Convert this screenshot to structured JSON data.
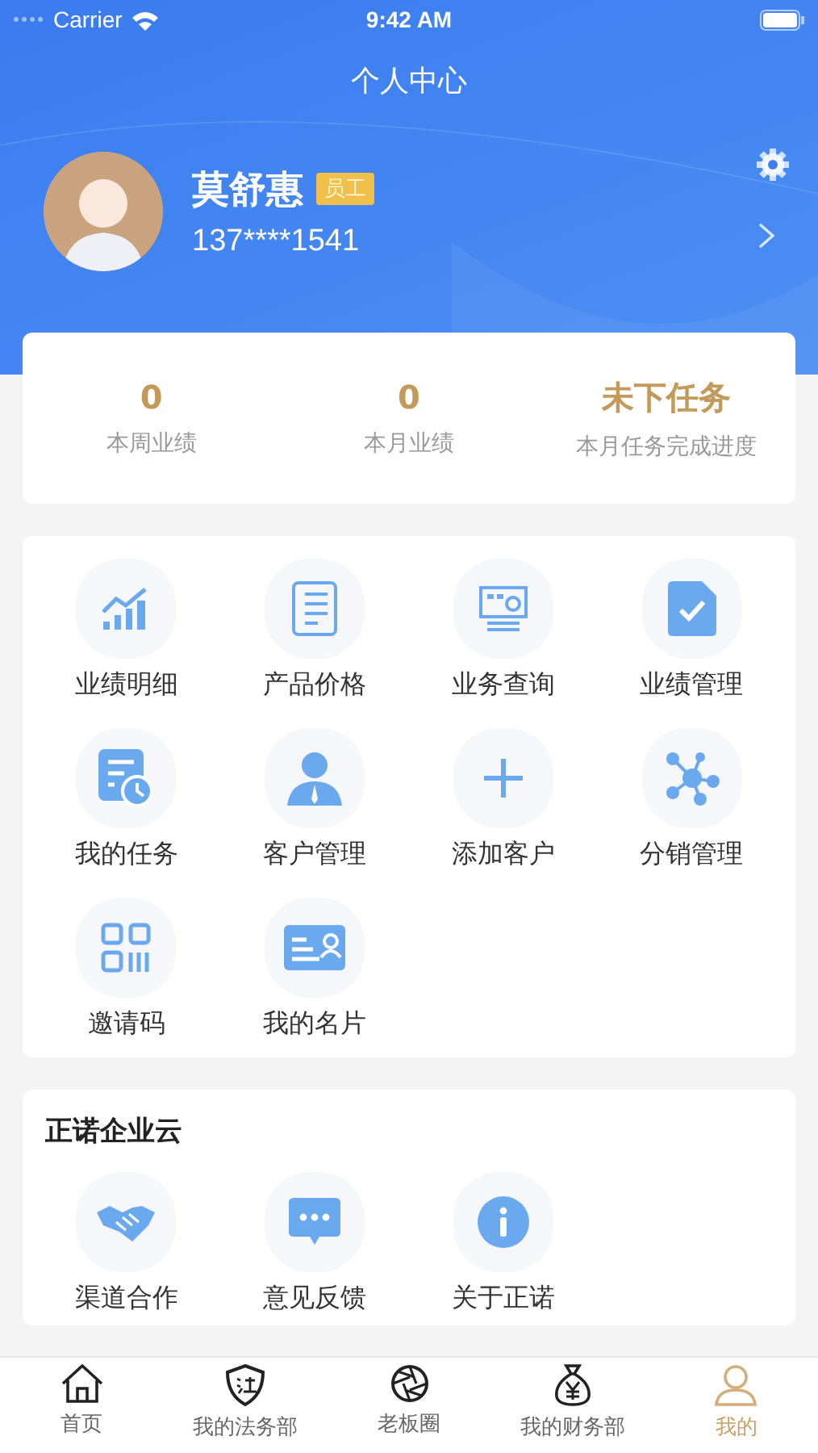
{
  "status_bar": {
    "carrier": "Carrier",
    "time": "9:42 AM"
  },
  "header": {
    "title": "个人中心"
  },
  "profile": {
    "name": "莫舒惠",
    "badge": "员工",
    "phone": "137****1541"
  },
  "stats": [
    {
      "value": "0",
      "label": "本周业绩"
    },
    {
      "value": "0",
      "label": "本月业绩"
    },
    {
      "value": "未下任务",
      "label": "本月任务完成进度"
    }
  ],
  "tools": [
    "业绩明细",
    "产品价格",
    "业务查询",
    "业绩管理",
    "我的任务",
    "客户管理",
    "添加客户",
    "分销管理",
    "邀请码",
    "我的名片"
  ],
  "cloud": {
    "title": "正诺企业云",
    "items": [
      "渠道合作",
      "意见反馈",
      "关于正诺"
    ]
  },
  "tab_bar": [
    {
      "label": "首页",
      "selected": false
    },
    {
      "label": "我的法务部",
      "selected": false
    },
    {
      "label": "老板圈",
      "selected": false
    },
    {
      "label": "我的财务部",
      "selected": false
    },
    {
      "label": "我的",
      "selected": true
    }
  ]
}
